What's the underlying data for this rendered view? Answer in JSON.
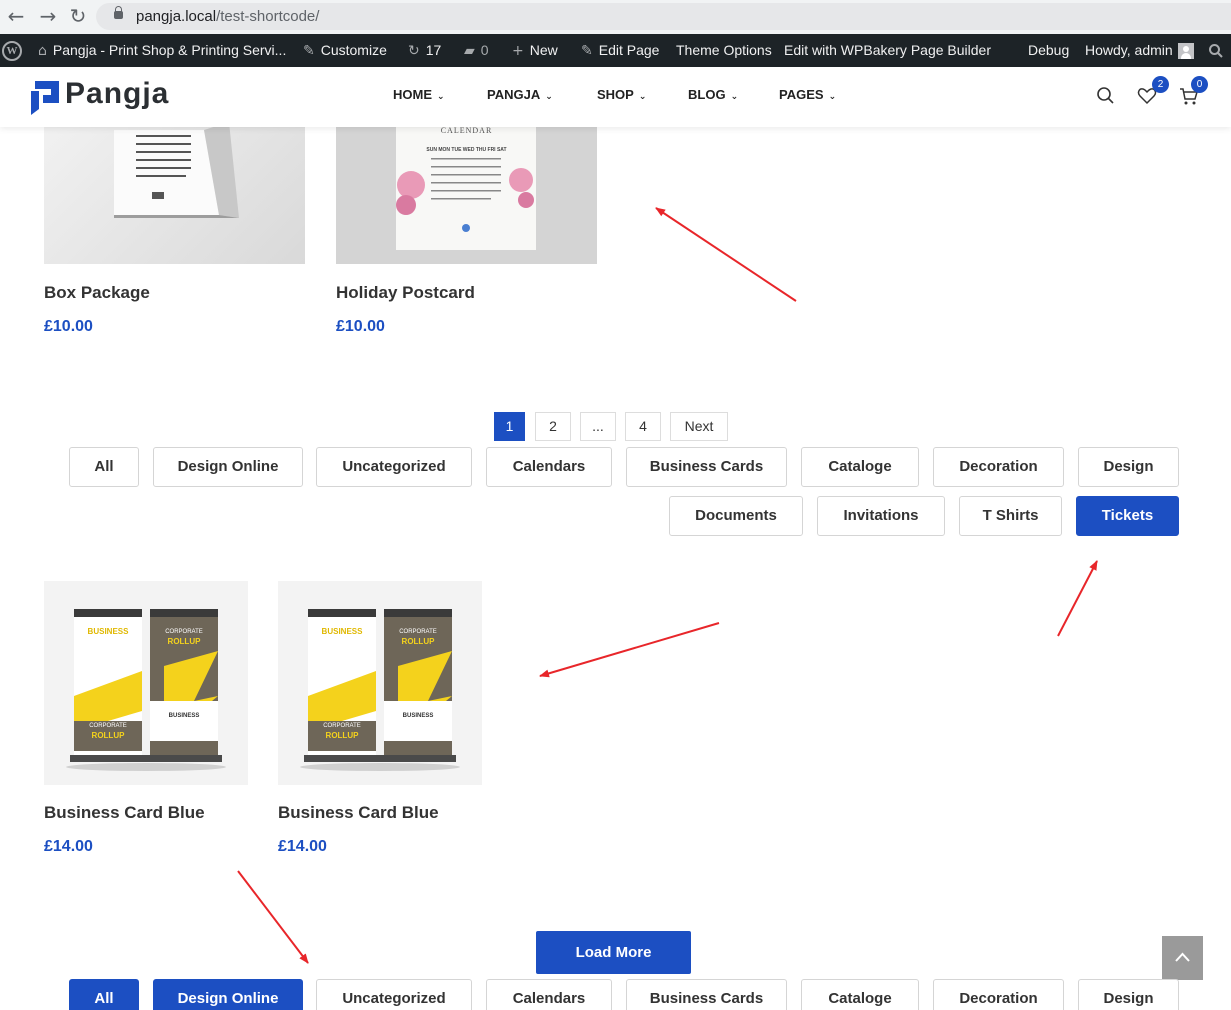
{
  "browser": {
    "url_host": "pangja.local",
    "url_path": "/test-shortcode/"
  },
  "admin_bar": {
    "site_name": "Pangja - Print Shop & Printing Servi...",
    "customize": "Customize",
    "updates_count": "17",
    "comments_count": "0",
    "new_label": "New",
    "edit_page": "Edit Page",
    "theme_options": "Theme Options",
    "wpbakery": "Edit with WPBakery Page Builder",
    "debug": "Debug",
    "howdy": "Howdy, admin"
  },
  "header": {
    "logo_text": "Pangja",
    "nav": [
      "HOME",
      "PANGJA",
      "SHOP",
      "BLOG",
      "PAGES"
    ],
    "wishlist_count": "2",
    "cart_count": "0"
  },
  "products_top": [
    {
      "title": "Box Package",
      "price": "£10.00",
      "image": "desk-calendar"
    },
    {
      "title": "Holiday Postcard",
      "price": "£10.00",
      "image": "floral-calendar"
    }
  ],
  "calendar_text": {
    "heading": "CALENDAR",
    "days": "SUN MON TUE WED THU FRI SAT"
  },
  "pagination": [
    "1",
    "2",
    "...",
    "4",
    "Next"
  ],
  "filters_1": [
    "All",
    "Design Online",
    "Uncategorized",
    "Calendars",
    "Business Cards",
    "Cataloge",
    "Decoration",
    "Design",
    "Documents",
    "Invitations",
    "T Shirts",
    "Tickets"
  ],
  "filters_1_active": "Tickets",
  "products_bottom": [
    {
      "title": "Business Card Blue",
      "price": "£14.00",
      "image": "rollup-banners"
    },
    {
      "title": "Business Card Blue",
      "price": "£14.00",
      "image": "rollup-banners"
    }
  ],
  "banner_text": {
    "business": "BUSINESS",
    "corporate": "CORPORATE",
    "rollup": "ROLLUP"
  },
  "load_more": "Load More",
  "filters_2": [
    "All",
    "Design Online",
    "Uncategorized",
    "Calendars",
    "Business Cards",
    "Cataloge",
    "Decoration",
    "Design"
  ],
  "filters_2_active": [
    "All",
    "Design Online"
  ],
  "colors": {
    "accent": "#1c4fc2",
    "admin_bar": "#1d2327",
    "annotation": "#e8262a"
  }
}
